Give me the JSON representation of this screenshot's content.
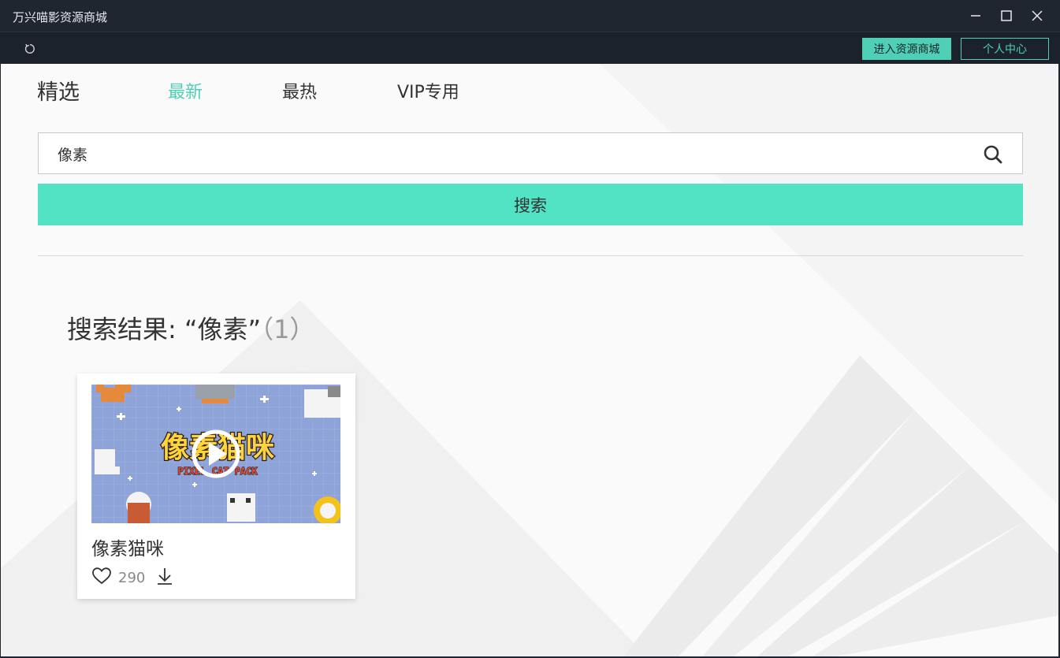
{
  "window": {
    "title": "万兴喵影资源商城",
    "controls": {
      "minimize_icon": "minimize-icon",
      "maximize_icon": "maximize-icon",
      "close_icon": "close-icon"
    }
  },
  "toolbar": {
    "refresh_icon": "refresh-icon",
    "store_label": "进入资源商城",
    "user_center_label": "个人中心"
  },
  "tabs": [
    {
      "label": "精选",
      "active": false
    },
    {
      "label": "最新",
      "active": true
    },
    {
      "label": "最热",
      "active": false
    },
    {
      "label": "VIP专用",
      "active": false
    }
  ],
  "search": {
    "value": "像素",
    "button_label": "搜索"
  },
  "results": {
    "prefix": "搜索结果: ",
    "query_quoted": "“像素”",
    "count_text": "（1）",
    "items": [
      {
        "title": "像素猫咪",
        "likes": "290",
        "thumbnail_title": "像素猫咪",
        "thumbnail_subtitle": "PIXEL CAT PACK"
      }
    ]
  },
  "colors": {
    "accent": "#4fcfb5",
    "search_button": "#51e3c4",
    "titlebar": "#1f2630",
    "thumbnail_bg": "#8ea3d8"
  }
}
